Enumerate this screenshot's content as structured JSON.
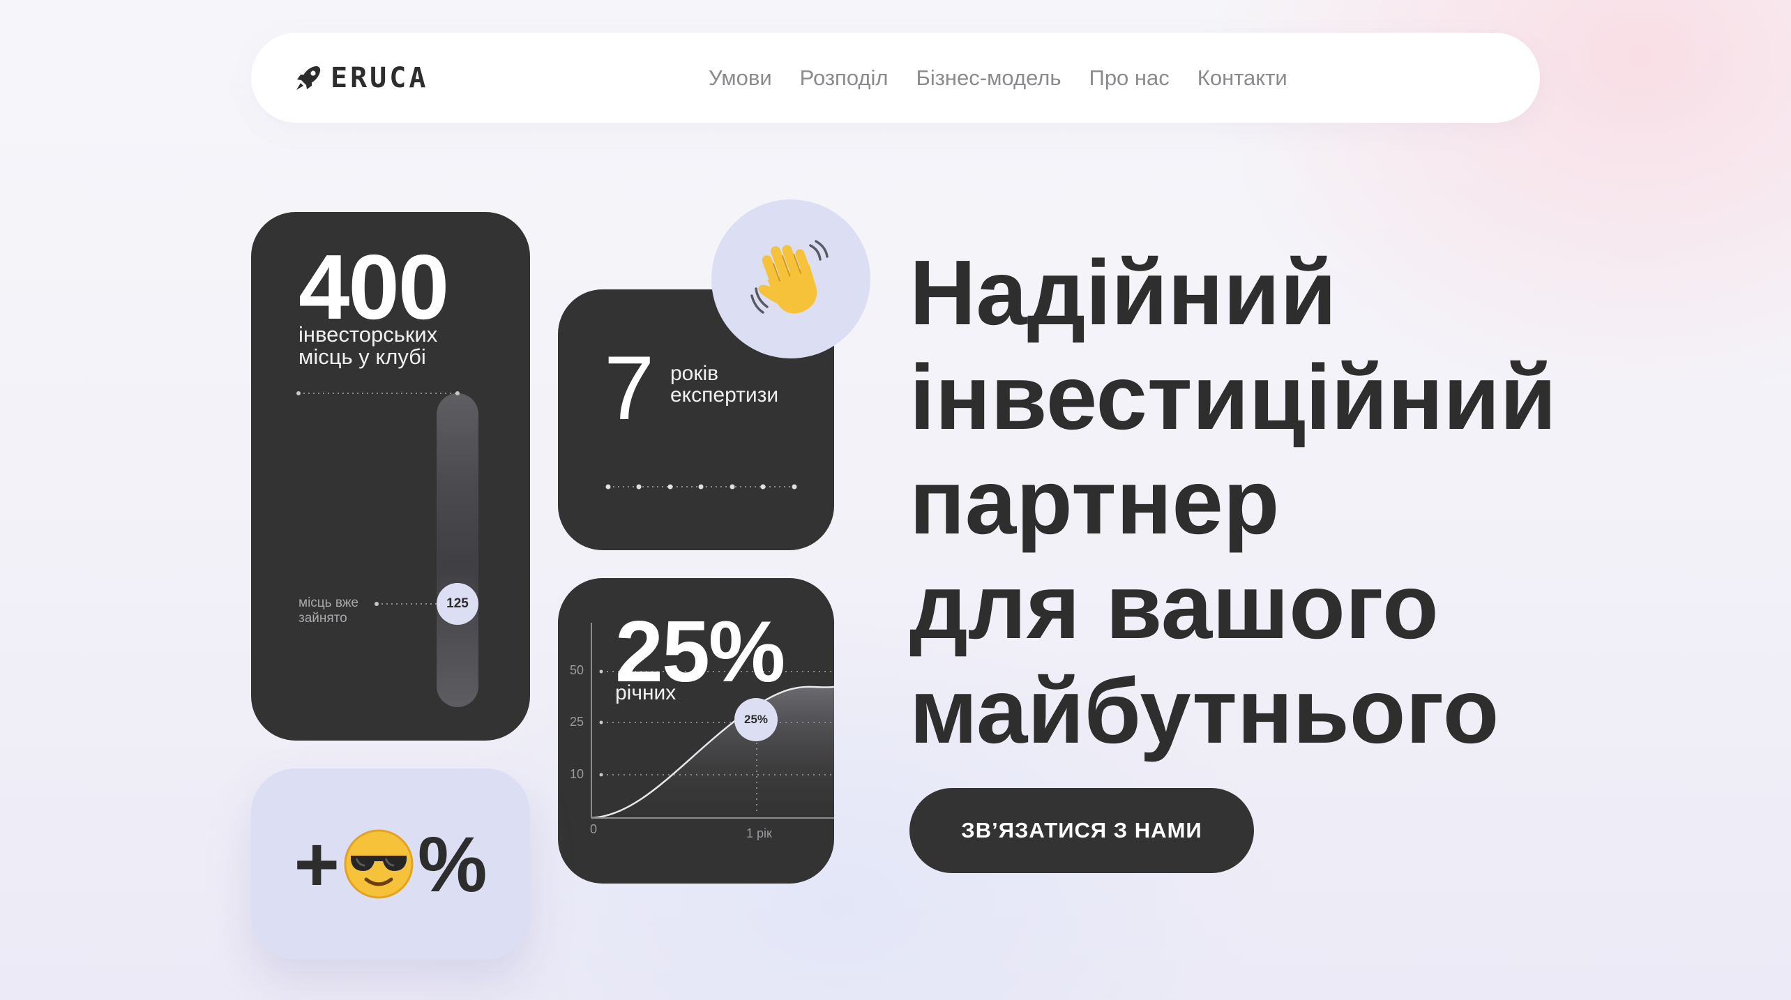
{
  "brand": {
    "name": "ERUCA",
    "icon": "rocket-icon"
  },
  "nav": {
    "links": [
      "Умови",
      "Розподіл",
      "Бізнес-модель",
      "Про нас",
      "Контакти"
    ]
  },
  "cards": {
    "members": {
      "value": "400",
      "label": "інвесторських місць у клубі",
      "taken_label": "місць вже зайнято",
      "taken_value": "125",
      "taken_fraction": 0.3125
    },
    "experience": {
      "value": "7",
      "label": "років експертизи",
      "icon": "waving-hand-icon"
    },
    "returns": {
      "value": "25%",
      "label": "річних",
      "marker": "25%",
      "y_ticks": [
        "50",
        "25",
        "10"
      ],
      "x_ticks": [
        "0",
        "1 рік"
      ]
    },
    "bonus": {
      "prefix": "+",
      "icon": "sunglasses-face-icon",
      "suffix": "%"
    }
  },
  "hero": {
    "title_lines": [
      "Надійний",
      "інвестиційний",
      "партнер",
      "для вашого",
      "майбутнього"
    ],
    "cta_label": "ЗВ’ЯЗАТИСЯ З НАМИ"
  },
  "colors": {
    "dark": "#333333",
    "accent": "#dcdef4",
    "text": "#2e2e2e",
    "nav_text": "#8a8a8f"
  }
}
